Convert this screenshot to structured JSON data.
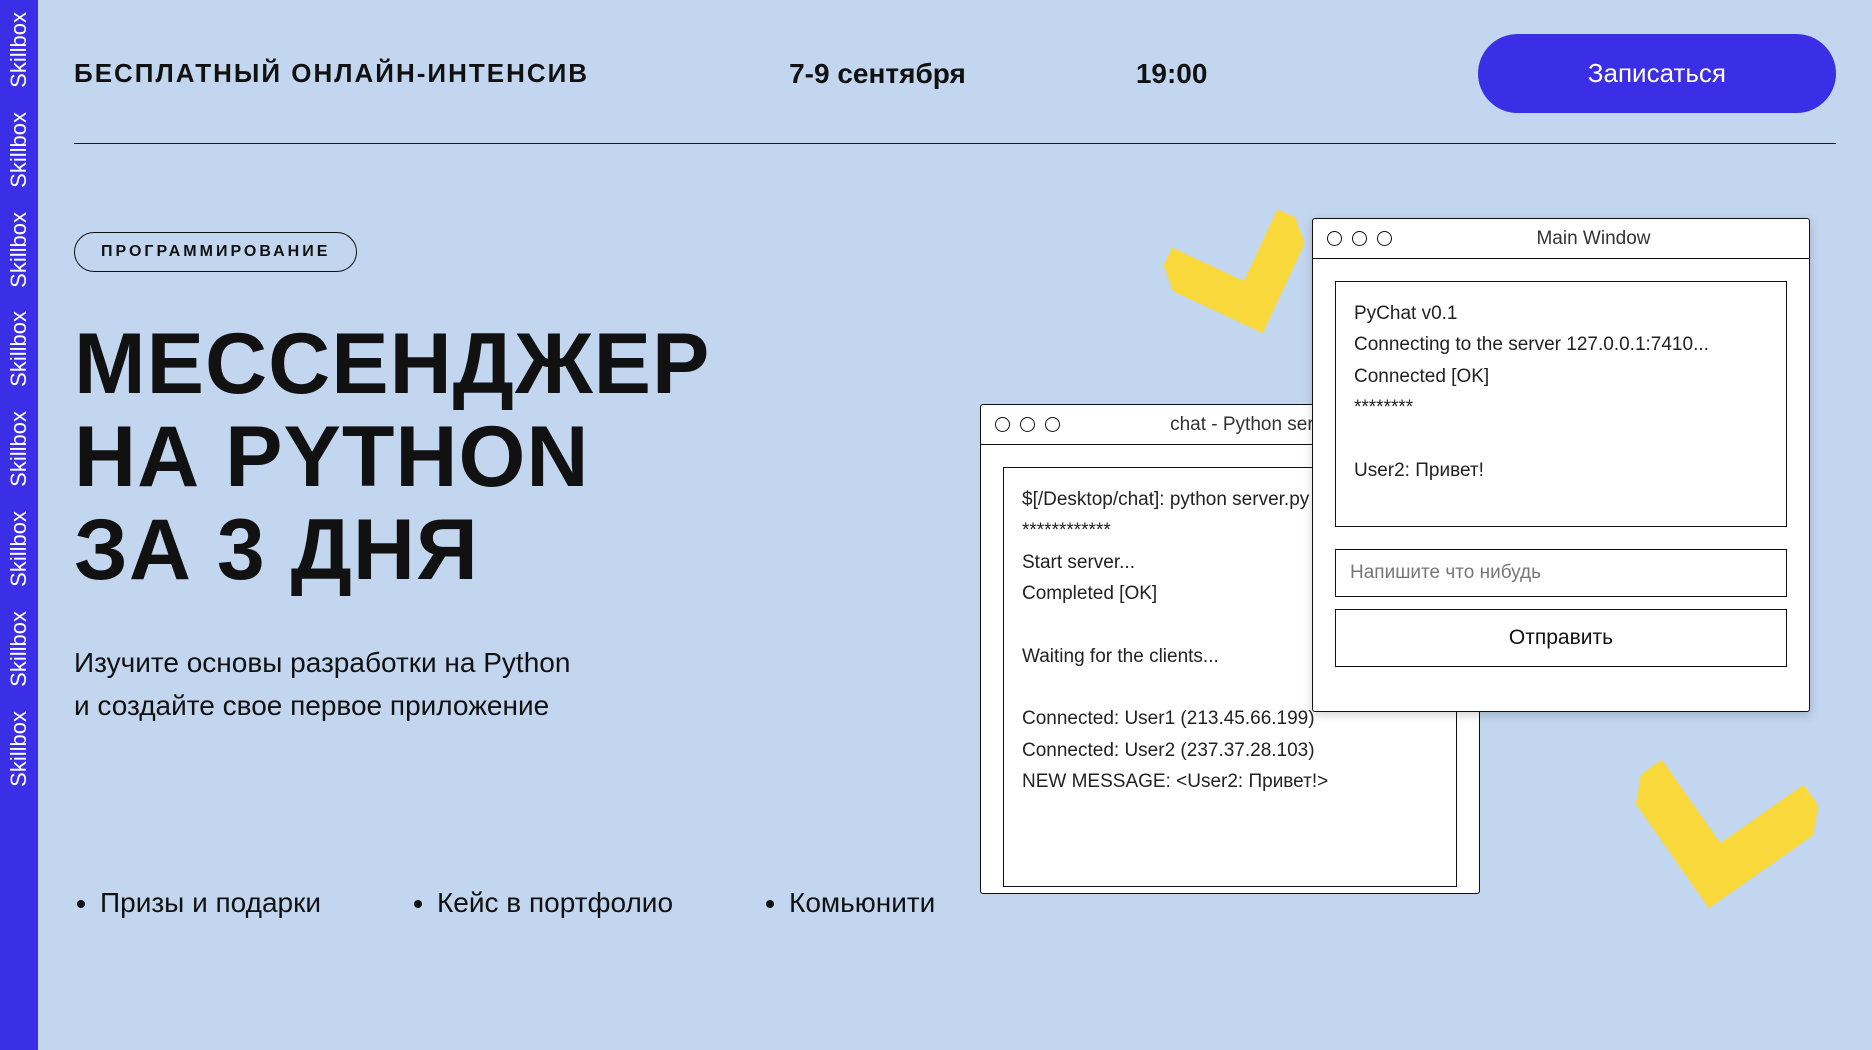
{
  "brand": "Skillbox",
  "header": {
    "label": "БЕСПЛАТНЫЙ ОНЛАЙН-ИНТЕНСИВ",
    "date": "7-9 сентября",
    "time": "19:00",
    "signup": "Записаться"
  },
  "badge": "ПРОГРАММИРОВАНИЕ",
  "headline_l1": "МЕССЕНДЖЕР",
  "headline_l2": "НА PYTHON",
  "headline_l3": "ЗА 3 ДНЯ",
  "subtitle_l1": "Изучите основы разработки на Python",
  "subtitle_l2": "и создайте свое первое приложение",
  "bullets": [
    "Призы и подарки",
    "Кейс в портфолио",
    "Комьюнити"
  ],
  "server_window": {
    "title": "chat - Python server.p",
    "lines": [
      "$[/Desktop/chat]: python server.py",
      "************",
      "Start server...",
      "Completed [OK]",
      "",
      "Waiting for the clients...",
      "",
      "Connected: User1 (213.45.66.199)",
      "Connected: User2 (237.37.28.103)",
      "NEW MESSAGE: <User2: Привет!>"
    ]
  },
  "main_window": {
    "title": "Main Window",
    "lines": [
      "PyChat v0.1",
      "Connecting to the server 127.0.0.1:7410...",
      "Connected [OK]",
      "********",
      "",
      "User2: Привет!"
    ],
    "input_placeholder": "Напишите что нибудь",
    "send_label": "Отправить"
  }
}
